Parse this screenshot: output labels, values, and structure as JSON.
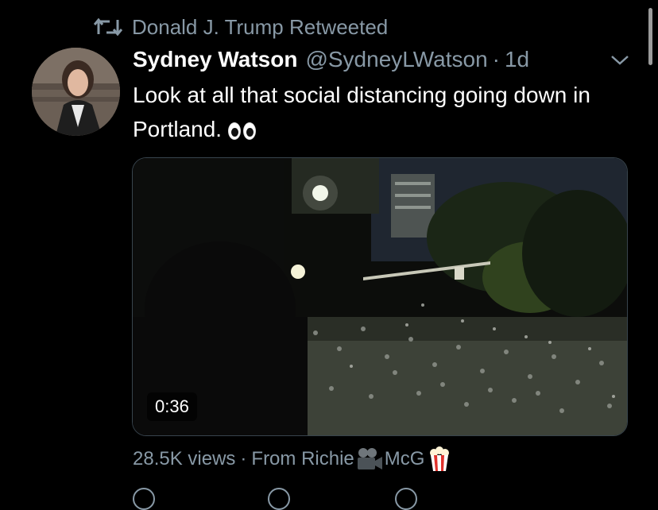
{
  "retweet": {
    "label": "Donald J. Trump Retweeted",
    "icon": "retweet-icon"
  },
  "tweet": {
    "author_name": "Sydney Watson",
    "handle": "@SydneyLWatson",
    "separator": "·",
    "age": "1d",
    "text": "Look at all that social distancing going down in Portland.",
    "emoji": "eyes-emoji"
  },
  "media": {
    "type": "video",
    "duration": "0:36"
  },
  "footer": {
    "views": "28.5K views",
    "separator": "·",
    "source_prefix": "From Richie",
    "source_suffix": "McG",
    "camera_emoji": "movie-camera-emoji",
    "popcorn_emoji": "popcorn-emoji"
  },
  "colors": {
    "background": "#000000",
    "text_primary": "#ffffff",
    "text_secondary": "#8899a6",
    "border": "#38444d"
  }
}
